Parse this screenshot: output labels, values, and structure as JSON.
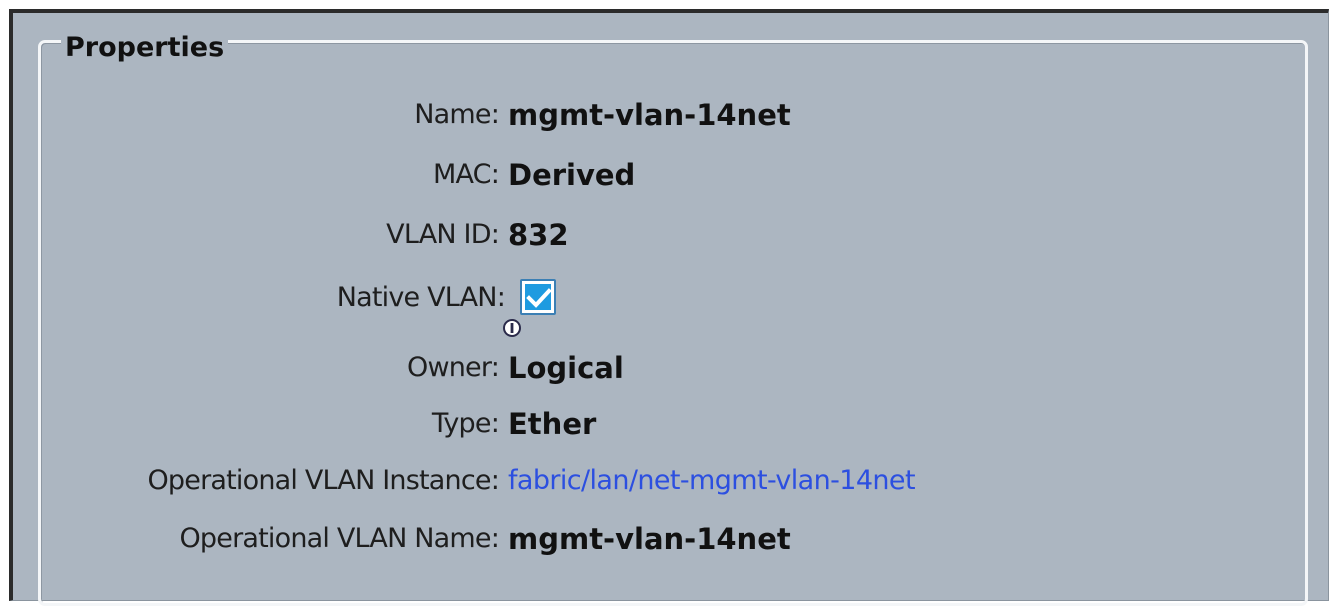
{
  "properties": {
    "legend": "Properties",
    "name_label": "Name:",
    "name_value": "mgmt-vlan-14net",
    "mac_label": "MAC:",
    "mac_value": "Derived",
    "vlan_id_label": "VLAN ID:",
    "vlan_id_value": "832",
    "native_vlan_label": "Native VLAN:",
    "native_vlan_checked": true,
    "owner_label": "Owner:",
    "owner_value": "Logical",
    "type_label": "Type:",
    "type_value": "Ether",
    "op_vlan_instance_label": "Operational VLAN Instance:",
    "op_vlan_instance_value": "fabric/lan/net-mgmt-vlan-14net",
    "op_vlan_name_label": "Operational VLAN Name:",
    "op_vlan_name_value": "mgmt-vlan-14net"
  },
  "colors": {
    "panel_background": "#acb6c1",
    "link": "#2c4fe0",
    "checkbox_fill": "#1e9be0"
  },
  "icons": {
    "checkbox": "check-icon",
    "info": "info-icon"
  }
}
